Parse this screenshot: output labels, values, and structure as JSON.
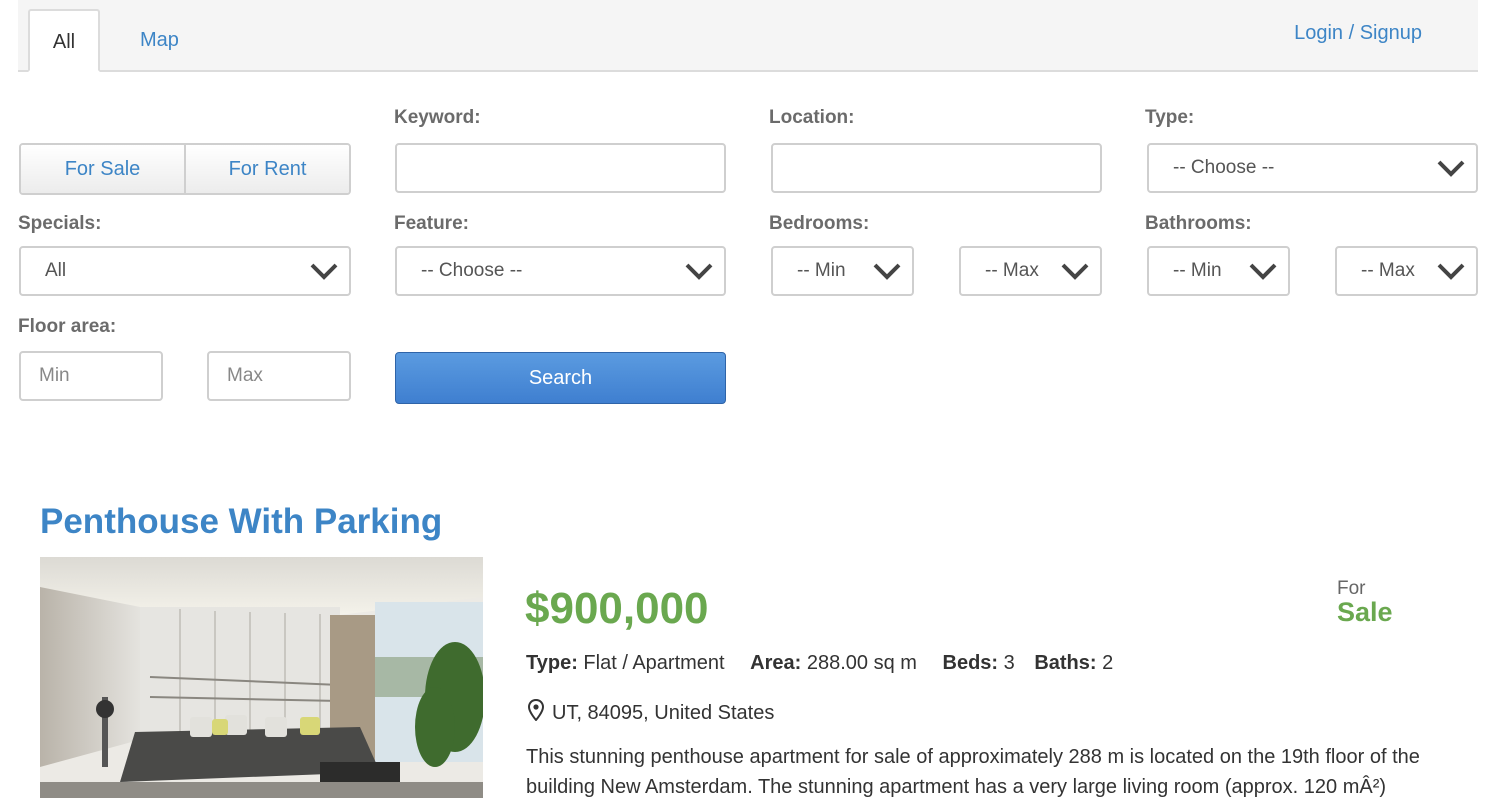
{
  "tabs": [
    {
      "label": "All",
      "active": true
    },
    {
      "label": "Map",
      "active": false
    }
  ],
  "header": {
    "login_label": "Login / Signup"
  },
  "search": {
    "listing_type": {
      "options": [
        "For Sale",
        "For Rent"
      ]
    },
    "keyword": {
      "label": "Keyword:",
      "value": "",
      "placeholder": ""
    },
    "location": {
      "label": "Location:",
      "value": "",
      "placeholder": ""
    },
    "type": {
      "label": "Type:",
      "selected": "-- Choose --"
    },
    "specials": {
      "label": "Specials:",
      "selected": "All"
    },
    "feature": {
      "label": "Feature:",
      "selected": "-- Choose --"
    },
    "bedrooms": {
      "label": "Bedrooms:",
      "min": "-- Min",
      "max": "-- Max"
    },
    "bathrooms": {
      "label": "Bathrooms:",
      "min": "-- Min",
      "max": "-- Max"
    },
    "floor_area": {
      "label": "Floor area:",
      "min_placeholder": "Min",
      "max_placeholder": "Max"
    },
    "search_label": "Search"
  },
  "listing": {
    "title": "Penthouse With Parking",
    "price": "$900,000",
    "status_prefix": "For",
    "status": "Sale",
    "type_label": "Type:",
    "type_value": "Flat / Apartment",
    "area_label": "Area:",
    "area_value": "288.00 sq m",
    "beds_label": "Beds:",
    "beds_value": "3",
    "baths_label": "Baths:",
    "baths_value": "2",
    "location": "UT, 84095, United States",
    "description": "This stunning penthouse apartment for sale of approximately 288 m is located on the 19th floor of the building New Amsterdam. The stunning apartment has a very large living room (approx. 120 mÂ²)"
  },
  "colors": {
    "link": "#3d85c6",
    "price": "#6aa84f",
    "search_button": "#4a8ad8"
  },
  "icons": {
    "select_arrow": "chevron-down-icon",
    "location": "map-pin-icon"
  }
}
